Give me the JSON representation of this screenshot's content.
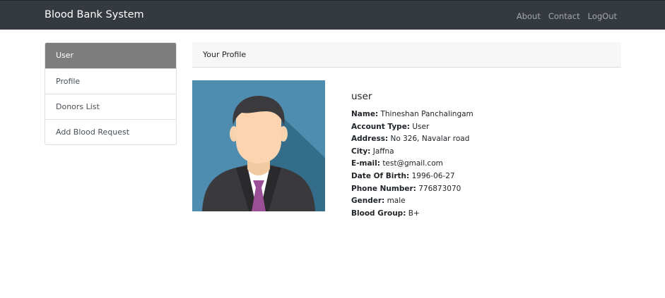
{
  "navbar": {
    "brand": "Blood Bank System",
    "links": [
      "About",
      "Contact",
      "LogOut"
    ]
  },
  "sidebar": {
    "items": [
      {
        "label": "User",
        "active": true
      },
      {
        "label": "Profile",
        "active": false
      },
      {
        "label": "Donors List",
        "active": false
      },
      {
        "label": "Add Blood Request",
        "active": false
      }
    ]
  },
  "card": {
    "header": "Your Profile"
  },
  "profile": {
    "username": "user",
    "fields": [
      {
        "label": "Name:",
        "value": "Thineshan Panchalingam"
      },
      {
        "label": "Account Type:",
        "value": "User"
      },
      {
        "label": "Address:",
        "value": "No 326, Navalar road"
      },
      {
        "label": "City:",
        "value": "Jaffna"
      },
      {
        "label": "E-mail:",
        "value": "test@gmail.com"
      },
      {
        "label": "Date Of Birth:",
        "value": "1996-06-27"
      },
      {
        "label": "Phone Number:",
        "value": "776873070"
      },
      {
        "label": "Gender:",
        "value": "male"
      },
      {
        "label": "Blood Group:",
        "value": "B+"
      }
    ]
  },
  "colors": {
    "navbar_bg": "#343a40",
    "active_item_bg": "#7d7d7d",
    "avatar_bg": "#4e8db0",
    "tie": "#9b4f96"
  },
  "icons": {
    "avatar": "businessman-avatar-icon"
  }
}
